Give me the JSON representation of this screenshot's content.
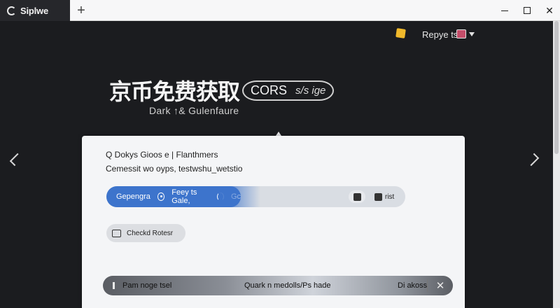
{
  "window": {
    "tab_label": "Siplwe",
    "new_tab": "+",
    "minimize": "",
    "maximize": "",
    "close": "✕"
  },
  "topbar": {
    "user_label": "Repye ts"
  },
  "hero": {
    "title": "京币免费获取",
    "pill_text": "CORS",
    "pill_small": "s/s ige",
    "subtitle": "Dark ↑& Gulenfaure"
  },
  "card": {
    "heading": "Q Dokys Gioos e | Flanthmers",
    "subheading": "Cemessit wo oyps, testwshu_wetstio",
    "action_row": {
      "primary_label": "Gepengra",
      "secondary_label": "Feey ts Gale,",
      "tertiary_label": "Gc",
      "tool_b_label": "rist"
    },
    "chip_label": "Checkd Rotesr",
    "footer": {
      "left": "Pam noge tsel",
      "middle": "Quark n medolls/Ps hade",
      "right": "Di akoss",
      "close": "✕"
    }
  }
}
